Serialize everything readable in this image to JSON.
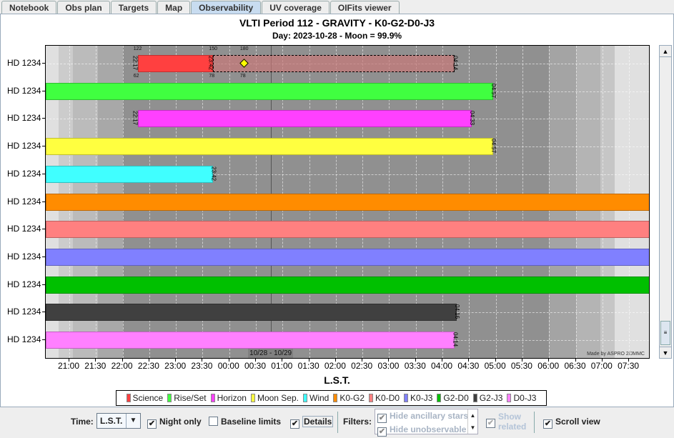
{
  "tabs": [
    "Notebook",
    "Obs plan",
    "Targets",
    "Map",
    "Observability",
    "UV coverage",
    "OIFits viewer"
  ],
  "active_tab": "Observability",
  "chart_data": {
    "type": "gantt",
    "title": "VLTI Period 112 - GRAVITY - K0-G2-D0-J3",
    "subtitle": "Day: 2023-10-28 - Moon = 99.9%",
    "xlabel": "L.S.T.",
    "xticks": [
      "21:00",
      "21:30",
      "22:00",
      "22:30",
      "23:00",
      "23:30",
      "00:00",
      "00:30",
      "01:00",
      "01:30",
      "02:00",
      "02:30",
      "03:00",
      "03:30",
      "04:00",
      "04:30",
      "05:00",
      "05:30",
      "06:00",
      "06:30",
      "07:00",
      "07:30"
    ],
    "date_marker": {
      "time": "00:47",
      "label": "10/28 - 10/29"
    },
    "credit": "Made by ASPRO 2/JMMC",
    "legend": [
      {
        "name": "Science",
        "color": "#ff4040"
      },
      {
        "name": "Rise/Set",
        "color": "#40ff40"
      },
      {
        "name": "Horizon",
        "color": "#ff40ff"
      },
      {
        "name": "Moon Sep.",
        "color": "#ffff40"
      },
      {
        "name": "Wind",
        "color": "#40ffff"
      },
      {
        "name": "K0-G2",
        "color": "#ff8c00"
      },
      {
        "name": "K0-D0",
        "color": "#ff8080"
      },
      {
        "name": "K0-J3",
        "color": "#8080ff"
      },
      {
        "name": "G2-D0",
        "color": "#00c000"
      },
      {
        "name": "G2-J3",
        "color": "#404040"
      },
      {
        "name": "D0-J3",
        "color": "#ff80ff"
      }
    ],
    "rows": [
      {
        "label": "HD 1234",
        "color": "#ff4040",
        "start": "22:17",
        "end": "23:42",
        "start_label": "22:17",
        "end_label": "23:42",
        "start_top": "122",
        "start_bottom": "62",
        "end_top": "150",
        "end_bottom": "78",
        "extension_end": "04:14",
        "extension_label": "04:14",
        "transit": "00:17",
        "transit_top": "180",
        "transit_bottom": "78"
      },
      {
        "label": "HD 1234",
        "color": "#40ff40",
        "start": "20:33",
        "end": "04:57",
        "end_label": "04:57"
      },
      {
        "label": "HD 1234",
        "color": "#ff40ff",
        "start": "22:17",
        "end": "04:33",
        "start_label": "22:17",
        "end_label": "04:33"
      },
      {
        "label": "HD 1234",
        "color": "#ffff40",
        "start": "20:33",
        "end": "04:57",
        "end_label": "04:57"
      },
      {
        "label": "HD 1234",
        "color": "#40ffff",
        "start": "20:33",
        "end": "23:42",
        "end_label": "23:42"
      },
      {
        "label": "HD 1234",
        "color": "#ff8c00",
        "start": "20:33",
        "end": "07:53"
      },
      {
        "label": "HD 1234",
        "color": "#ff8080",
        "start": "20:33",
        "end": "07:53"
      },
      {
        "label": "HD 1234",
        "color": "#8080ff",
        "start": "20:33",
        "end": "07:53"
      },
      {
        "label": "HD 1234",
        "color": "#00c000",
        "start": "20:33",
        "end": "07:53"
      },
      {
        "label": "HD 1234",
        "color": "#404040",
        "start": "20:33",
        "end": "04:16",
        "end_label": "04:16"
      },
      {
        "label": "HD 1234",
        "color": "#ff80ff",
        "start": "20:33",
        "end": "04:14",
        "end_label": "04:14"
      }
    ],
    "twilight_bands": [
      {
        "start": "20:33",
        "end": "20:48",
        "color": "#e0e0e0"
      },
      {
        "start": "20:48",
        "end": "21:04",
        "color": "#cccccc"
      },
      {
        "start": "21:04",
        "end": "21:32",
        "color": "#bbbbbb"
      },
      {
        "start": "21:32",
        "end": "22:00",
        "color": "#a8a8a8"
      },
      {
        "start": "06:00",
        "end": "06:30",
        "color": "#a4a4a4"
      },
      {
        "start": "06:30",
        "end": "06:58",
        "color": "#b4b4b4"
      },
      {
        "start": "06:58",
        "end": "07:14",
        "color": "#c6c6c6"
      },
      {
        "start": "07:14",
        "end": "07:53",
        "color": "#e0e0e0"
      }
    ]
  },
  "controls": {
    "time_label": "Time:",
    "time_value": "L.S.T.",
    "night_only": {
      "label": "Night only",
      "checked": true
    },
    "baseline_limits": {
      "label": "Baseline limits",
      "checked": false
    },
    "details": {
      "label": "Details",
      "checked": true
    },
    "filters_label": "Filters:",
    "filters": [
      {
        "label": "Hide ancillary stars",
        "checked": true
      },
      {
        "label": "Hide unobservable",
        "checked": true
      }
    ],
    "show_related": {
      "label1": "Show",
      "label2": "related",
      "checked": true
    },
    "scroll_view": {
      "label": "Scroll view",
      "checked": true
    }
  }
}
